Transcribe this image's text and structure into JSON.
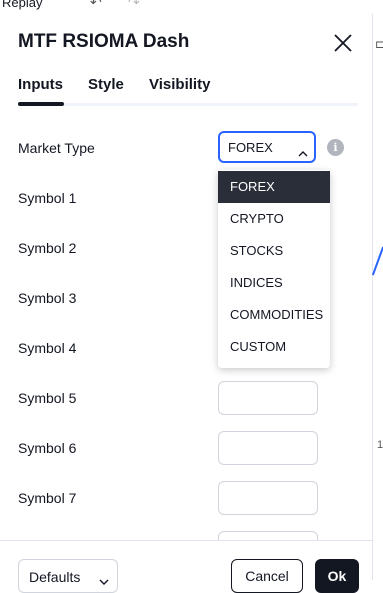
{
  "background": {
    "replay_label": "Replay",
    "chart_glyph_1": "⊏",
    "chart_number": "1"
  },
  "dialog": {
    "title": "MTF RSIOMA Dash",
    "tabs": [
      {
        "label": "Inputs",
        "active": true
      },
      {
        "label": "Style",
        "active": false
      },
      {
        "label": "Visibility",
        "active": false
      }
    ],
    "market_type": {
      "label": "Market Type",
      "value": "FOREX",
      "info_icon": "i",
      "options": [
        "FOREX",
        "CRYPTO",
        "STOCKS",
        "INDICES",
        "COMMODITIES",
        "CUSTOM"
      ]
    },
    "symbols": [
      {
        "label": "Symbol 1",
        "value": ""
      },
      {
        "label": "Symbol 2",
        "value": ""
      },
      {
        "label": "Symbol 3",
        "value": ""
      },
      {
        "label": "Symbol 4",
        "value": ""
      },
      {
        "label": "Symbol 5",
        "value": ""
      },
      {
        "label": "Symbol 6",
        "value": ""
      },
      {
        "label": "Symbol 7",
        "value": ""
      }
    ],
    "footer": {
      "defaults_label": "Defaults",
      "cancel_label": "Cancel",
      "ok_label": "Ok"
    }
  },
  "colors": {
    "accent_blue": "#2962ff",
    "dark": "#131722",
    "selected_option_bg": "#2a2e39"
  }
}
